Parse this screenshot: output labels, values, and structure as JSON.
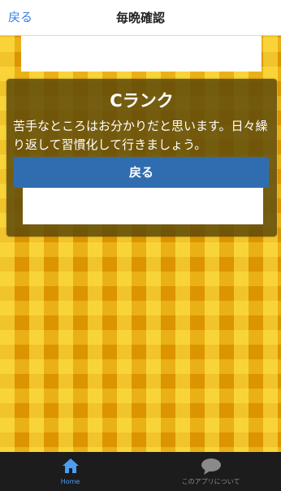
{
  "navbar": {
    "back_label": "戻る",
    "title": "毎晩確認"
  },
  "dialog": {
    "title": "Cランク",
    "message": "苦手なところはお分かりだと思います。日々繰り返して習慣化して行きましょう。",
    "button_label": "戻る"
  },
  "tabbar": {
    "items": [
      {
        "label": "Home",
        "icon": "home-icon",
        "selected": true
      },
      {
        "label": "このアプリについて",
        "icon": "speech-bubble-icon",
        "selected": false
      }
    ]
  },
  "colors": {
    "accent": "#3b7fe0",
    "dialog_button": "#2f6db0",
    "tab_active": "#4c9df0",
    "tab_inactive": "#8a8a8a",
    "background": "#e8a400"
  }
}
